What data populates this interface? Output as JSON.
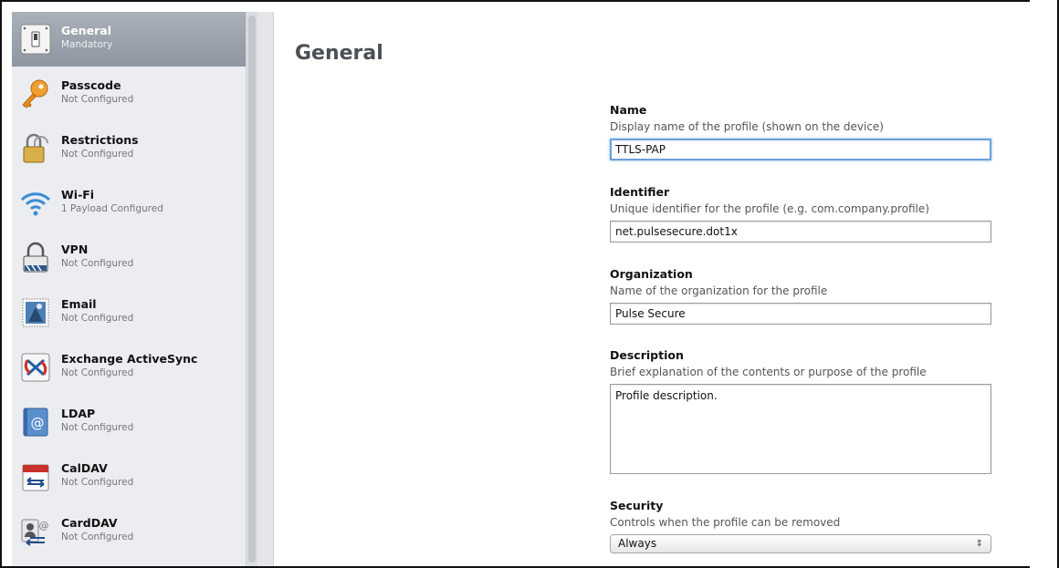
{
  "sidebar": {
    "items": [
      {
        "title": "General",
        "subtitle": "Mandatory",
        "icon": "switch-icon"
      },
      {
        "title": "Passcode",
        "subtitle": "Not Configured",
        "icon": "key-icon"
      },
      {
        "title": "Restrictions",
        "subtitle": "Not Configured",
        "icon": "padlock-icon"
      },
      {
        "title": "Wi-Fi",
        "subtitle": "1 Payload Configured",
        "icon": "wifi-icon"
      },
      {
        "title": "VPN",
        "subtitle": "Not Configured",
        "icon": "vpn-lock-icon"
      },
      {
        "title": "Email",
        "subtitle": "Not Configured",
        "icon": "email-stamp-icon"
      },
      {
        "title": "Exchange ActiveSync",
        "subtitle": "Not Configured",
        "icon": "exchange-icon"
      },
      {
        "title": "LDAP",
        "subtitle": "Not Configured",
        "icon": "ldap-at-icon"
      },
      {
        "title": "CalDAV",
        "subtitle": "Not Configured",
        "icon": "calendar-icon"
      },
      {
        "title": "CardDAV",
        "subtitle": "Not Configured",
        "icon": "contacts-icon"
      }
    ]
  },
  "main": {
    "title": "General",
    "name": {
      "label": "Name",
      "help": "Display name of the profile (shown on the device)",
      "value": "TTLS-PAP"
    },
    "identifier": {
      "label": "Identifier",
      "help": "Unique identifier for the profile (e.g. com.company.profile)",
      "value": "net.pulsesecure.dot1x"
    },
    "organization": {
      "label": "Organization",
      "help": "Name of the organization for the profile",
      "value": "Pulse Secure"
    },
    "description": {
      "label": "Description",
      "help": "Brief explanation of the contents or purpose of the profile",
      "value": "Profile description."
    },
    "security": {
      "label": "Security",
      "help": "Controls when the profile can be removed",
      "value": "Always"
    }
  },
  "colors": {
    "selected_row": "#9aa1ab",
    "focus_ring": "#6aa0dc",
    "sidebar_bg": "#ebedf1"
  }
}
